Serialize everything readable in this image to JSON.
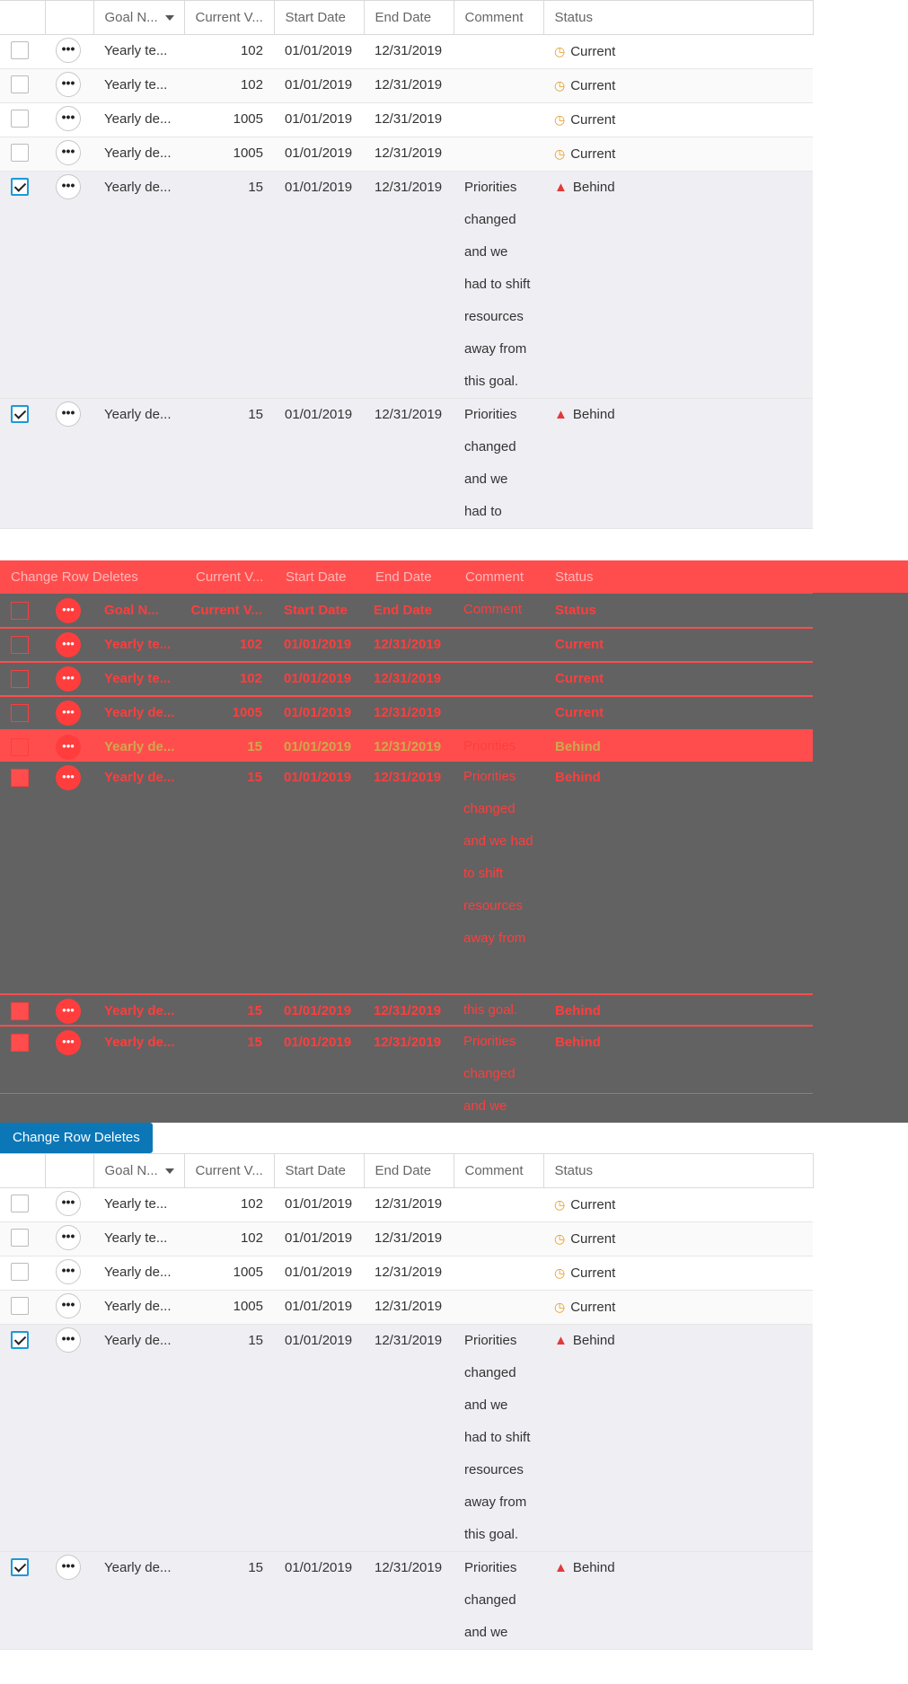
{
  "columns": [
    "",
    "",
    "Goal N...",
    "Current V...",
    "Start Date",
    "End Date",
    "Comment",
    "Status"
  ],
  "overlay_label": "Change Row Deletes",
  "button_label": "Change Row Deletes",
  "status_labels": {
    "current": "Current",
    "behind": "Behind"
  },
  "grids": {
    "top": {
      "rows": [
        {
          "checked": false,
          "goal": "Yearly te...",
          "current": "102",
          "start": "01/01/2019",
          "end": "12/31/2019",
          "comment": "",
          "status": "Current"
        },
        {
          "checked": false,
          "goal": "Yearly te...",
          "current": "102",
          "start": "01/01/2019",
          "end": "12/31/2019",
          "comment": "",
          "status": "Current"
        },
        {
          "checked": false,
          "goal": "Yearly de...",
          "current": "1005",
          "start": "01/01/2019",
          "end": "12/31/2019",
          "comment": "",
          "status": "Current"
        },
        {
          "checked": false,
          "goal": "Yearly de...",
          "current": "1005",
          "start": "01/01/2019",
          "end": "12/31/2019",
          "comment": "",
          "status": "Current"
        },
        {
          "checked": true,
          "goal": "Yearly de...",
          "current": "15",
          "start": "01/01/2019",
          "end": "12/31/2019",
          "comment": "Priorities changed and we had to shift resources away from this goal.",
          "status": "Behind"
        },
        {
          "checked": true,
          "goal": "Yearly de...",
          "current": "15",
          "start": "01/01/2019",
          "end": "12/31/2019",
          "comment": "Priorities changed and we had to",
          "status": "Behind"
        }
      ]
    },
    "bottom": {
      "rows": [
        {
          "checked": false,
          "goal": "Yearly te...",
          "current": "102",
          "start": "01/01/2019",
          "end": "12/31/2019",
          "comment": "",
          "status": "Current"
        },
        {
          "checked": false,
          "goal": "Yearly te...",
          "current": "102",
          "start": "01/01/2019",
          "end": "12/31/2019",
          "comment": "",
          "status": "Current"
        },
        {
          "checked": false,
          "goal": "Yearly de...",
          "current": "1005",
          "start": "01/01/2019",
          "end": "12/31/2019",
          "comment": "",
          "status": "Current"
        },
        {
          "checked": false,
          "goal": "Yearly de...",
          "current": "1005",
          "start": "01/01/2019",
          "end": "12/31/2019",
          "comment": "",
          "status": "Current"
        },
        {
          "checked": true,
          "goal": "Yearly de...",
          "current": "15",
          "start": "01/01/2019",
          "end": "12/31/2019",
          "comment": "Priorities changed and we had to shift resources away from this goal.",
          "status": "Behind"
        },
        {
          "checked": true,
          "goal": "Yearly de...",
          "current": "15",
          "start": "01/01/2019",
          "end": "12/31/2019",
          "comment": "Priorities changed and we",
          "status": "Behind"
        }
      ]
    }
  },
  "overlay": {
    "rows": [
      {
        "checked": false,
        "goal": "Goal N...",
        "current": "Current V...",
        "start": "Start Date",
        "end": "End Date",
        "comment": "Comment",
        "status": "Status"
      },
      {
        "checked": false,
        "goal": "Yearly te...",
        "current": "102",
        "start": "01/01/2019",
        "end": "12/31/2019",
        "comment": "",
        "status": "Current"
      },
      {
        "checked": false,
        "goal": "Yearly te...",
        "current": "102",
        "start": "01/01/2019",
        "end": "12/31/2019",
        "comment": "",
        "status": "Current"
      },
      {
        "checked": false,
        "goal": "Yearly de...",
        "current": "1005",
        "start": "01/01/2019",
        "end": "12/31/2019",
        "comment": "",
        "status": "Current"
      },
      {
        "checked": true,
        "goal": "Yearly de...",
        "current": "15",
        "start": "01/01/2019",
        "end": "12/31/2019",
        "comment": "Priorities",
        "status": "Behind"
      },
      {
        "checked": true,
        "goal": "Yearly de...",
        "current": "15",
        "start": "01/01/2019",
        "end": "12/31/2019",
        "comment": "Priorities changed and we had to shift resources away from",
        "status": "Behind"
      },
      {
        "checked": true,
        "goal": "Yearly de...",
        "current": "15",
        "start": "01/01/2019",
        "end": "12/31/2019",
        "comment": "this goal.",
        "status": "Behind"
      },
      {
        "checked": true,
        "goal": "Yearly de...",
        "current": "15",
        "start": "01/01/2019",
        "end": "12/31/2019",
        "comment": "Priorities changed and we",
        "status": "Behind"
      }
    ]
  },
  "colors": {
    "accent": "#0c77b7",
    "behind": "#e03a3a",
    "current": "#e29c28",
    "overlay": "#ff4d4d"
  },
  "icons": {
    "current": "clock-icon",
    "behind": "warning-triangle-icon",
    "more": "more-dots-icon"
  }
}
